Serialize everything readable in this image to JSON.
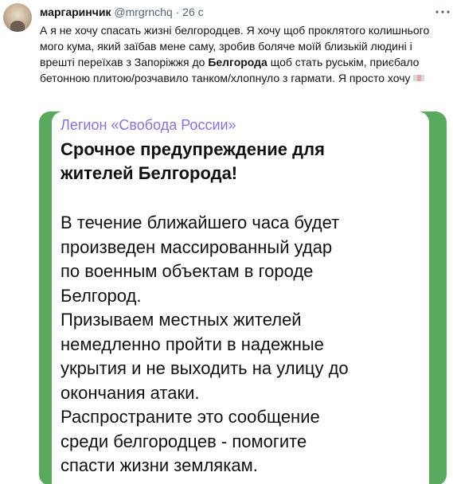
{
  "tweet": {
    "display_name": "маргаринчик",
    "handle": "@mrgrnchq",
    "separator": "·",
    "time": "26 с",
    "text_before_bold": "А я не хочу спасать жизні белгородцев. Я хочу щоб проклятого колишнього мого кума, який заїбав мене саму, зробив боляче моїй близькій людині і врешті переїхав з Запоріжжя до ",
    "text_bold": "Белгорода",
    "text_after_bold": " щоб стать руськім, приєбало бетонною плитою/розчавило танком/хлопнуло з гармати. Я просто хочу",
    "avatar_icon": "avatar",
    "more_icon": "more-dots-icon",
    "emoji_icon": "flag-emoji-icon"
  },
  "media": {
    "background_color": "#59a95e",
    "sender_color": "#8e6fd6",
    "sender": "Легион «Свобода России»",
    "title": "Срочное предупреждение для жителей Белгорода!",
    "body_lines": [
      "В течение ближайшего часа будет",
      "произведен массированный удар",
      "по военным объектам в городе",
      "Белгород.",
      "Призываем местных жителей",
      "немедленно пройти в надежные",
      "укрытия и не выходить на улицу до",
      "окончания атаки.",
      "Распространите это сообщение",
      "среди белгородцев - помогите",
      "спасти жизни землякам."
    ]
  }
}
